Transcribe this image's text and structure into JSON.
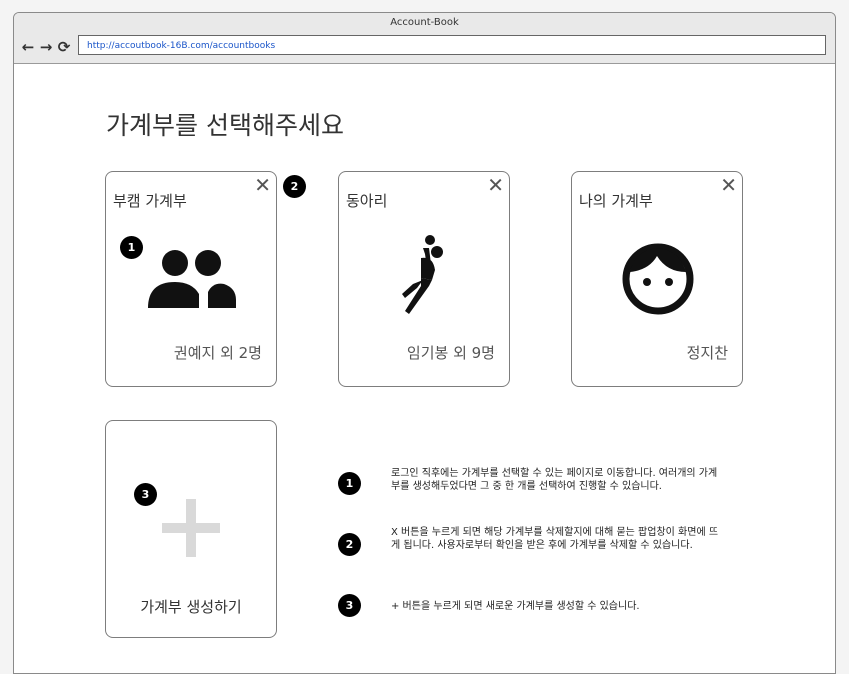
{
  "browser": {
    "window_title": "Account-Book",
    "url": "http://accoutbook-16B.com/accountbooks",
    "nav_back": "←",
    "nav_forward": "→",
    "nav_reload": "⟳"
  },
  "page": {
    "heading": "가계부를 선택해주세요"
  },
  "cards": [
    {
      "title": "부캠 가계부",
      "members": "권예지 외 2명",
      "close": "✕"
    },
    {
      "title": "동아리",
      "members": "임기봉 외 9명",
      "close": "✕"
    },
    {
      "title": "나의 가계부",
      "members": "정지찬",
      "close": "✕"
    }
  ],
  "create_card": {
    "label": "가계부 생성하기"
  },
  "badges": [
    "1",
    "2",
    "3"
  ],
  "notes": [
    {
      "num": "1",
      "text": "로그인 직후에는 가계부를 선택할 수 있는 페이지로 이동합니다. 여러개의 가계부를 생성해두었다면 그 중 한 개를 선택하여 진행할 수 있습니다."
    },
    {
      "num": "2",
      "text": " X 버튼을 누르게 되면 해당 가계부를 삭제할지에 대해 묻는 팝업창이 화면에 뜨게 됩니다. 사용자로부터 확인을 받은 후에 가계부를 삭제할 수 있습니다."
    },
    {
      "num": "3",
      "text": "+ 버튼을 누르게 되면 새로운 가계부를 생성할 수 있습니다."
    }
  ],
  "icons": {
    "group": "group-icon",
    "sport": "handball-icon",
    "person": "face-icon",
    "plus": "plus-icon"
  }
}
